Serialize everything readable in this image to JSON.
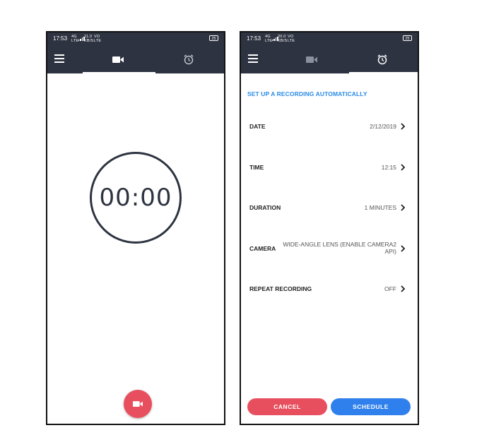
{
  "status_bar": {
    "time": "17:53",
    "net1_top": "4G",
    "net1_bottom": "LTE",
    "speed_top": "11.0",
    "speed_bottom": "KB/S",
    "volte_top": "VO",
    "volte_bottom": "LTE",
    "battery": "25"
  },
  "status_bar_right": {
    "time": "17:53",
    "net1_top": "4G",
    "net1_bottom": "LTE",
    "speed_top": "20.0",
    "speed_bottom": "KB/S",
    "volte_top": "VO",
    "volte_bottom": "LTE",
    "battery": "25"
  },
  "recorder": {
    "timer": "00:00",
    "active_tab": "camera",
    "tabs": [
      {
        "id": "camera",
        "icon": "video-camera-icon"
      },
      {
        "id": "schedule",
        "icon": "alarm-clock-icon"
      }
    ],
    "record_button_icon": "video-camera-icon"
  },
  "scheduler": {
    "active_tab": "schedule",
    "section_title": "SET UP A RECORDING AUTOMATICALLY",
    "rows": [
      {
        "label": "DATE",
        "value": "2/12/2019"
      },
      {
        "label": "TIME",
        "value": "12:15"
      },
      {
        "label": "DURATION",
        "value": "1 MINUTES"
      },
      {
        "label": "CAMERA",
        "value": "WIDE-ANGLE LENS (ENABLE CAMERA2 API)"
      },
      {
        "label": "REPEAT RECORDING",
        "value": "OFF"
      }
    ],
    "cancel_label": "CANCEL",
    "schedule_label": "SCHEDULE"
  },
  "colors": {
    "appbar": "#2d3340",
    "accent_blue": "#2b8be6",
    "record_red": "#e84f5e",
    "schedule_blue": "#2f80ed"
  }
}
